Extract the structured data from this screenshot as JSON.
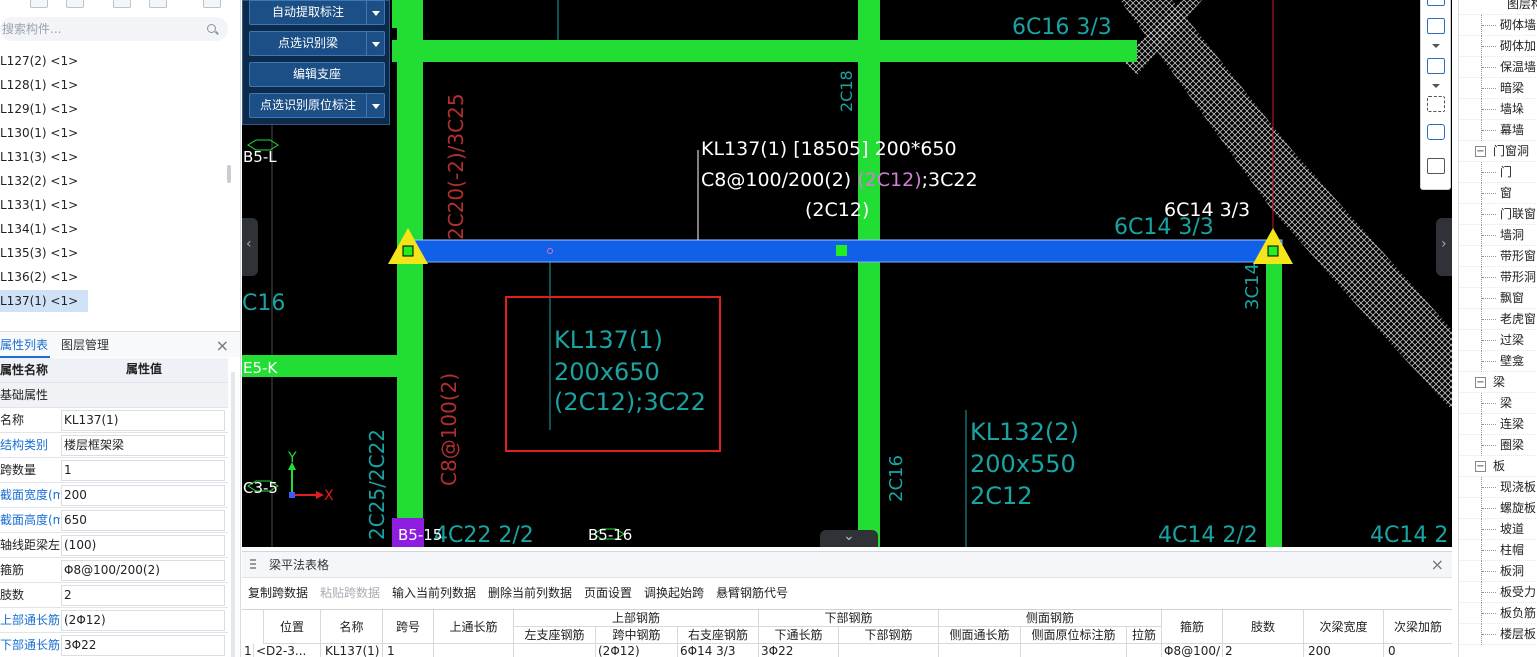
{
  "left_panel": {
    "search_placeholder": "搜索构件...",
    "component_list": [
      "L127(2) <1>",
      "L128(1) <1>",
      "L129(1) <1>",
      "L130(1) <1>",
      "L131(3) <1>",
      "L132(2) <1>",
      "L133(1) <1>",
      "L134(1) <1>",
      "L135(3) <1>",
      "L136(2) <1>",
      "L137(1) <1>"
    ],
    "selected_item": "L137(1) <1>",
    "tabs": [
      "属性列表",
      "图层管理"
    ],
    "prop_header": {
      "name": "属性名称",
      "value": "属性值"
    },
    "prop_group": "基础属性",
    "properties": [
      {
        "name": "名称",
        "value": "KL137(1)",
        "blue": false
      },
      {
        "name": "结构类别",
        "value": "楼层框架梁",
        "blue": true
      },
      {
        "name": "跨数量",
        "value": "1",
        "blue": false
      },
      {
        "name": "截面宽度(mm)",
        "value": "200",
        "blue": true
      },
      {
        "name": "截面高度(mm)",
        "value": "650",
        "blue": true
      },
      {
        "name": "轴线距梁左...",
        "value": "(100)",
        "blue": false
      },
      {
        "name": "箍筋",
        "value": "Φ8@100/200(2)",
        "blue": false
      },
      {
        "name": "肢数",
        "value": "2",
        "blue": false
      },
      {
        "name": "上部通长筋",
        "value": "(2Φ12)",
        "blue": true
      },
      {
        "name": "下部通长筋",
        "value": "3Φ22",
        "blue": true
      }
    ]
  },
  "tool_panel": {
    "buttons": [
      {
        "label": "自动提取标注",
        "has_dropdown": true
      },
      {
        "label": "点选识别梁",
        "has_dropdown": true
      },
      {
        "label": "编辑支座",
        "has_dropdown": false
      },
      {
        "label": "点选识别原位标注",
        "has_dropdown": true
      }
    ]
  },
  "canvas": {
    "beam_label_line1": "KL137(1) [18505] 200*650",
    "beam_label_line2_a": "C8@100/200(2) ",
    "beam_label_line2_b": "(2C12)",
    "beam_label_line2_c": ";3C22",
    "beam_label_line3": "(2C12)",
    "right_support_label": "6C14 3/3",
    "cad_texts": {
      "t_6c16": "6C16 3/3",
      "t_2c18": "2C18",
      "t_2c20": "2C20(-2)/3C25",
      "t_6c14": "6C14 3/3",
      "t_3c14": "3C14",
      "t_c16": "C16",
      "t_kl137_1": "KL137(1)",
      "t_kl137_2": "200x650",
      "t_kl137_3": "(2C12);3C22",
      "t_kl132_1": "KL132(2)",
      "t_kl132_2": "200x550",
      "t_kl132_3": "2C12",
      "t_2c25": "2C25/2C22",
      "t_c8": "C8@100(2)",
      "t_2c16": "2C16",
      "t_4c22": "4C22 2/2",
      "t_4c14a": "4C14 2/2",
      "t_4c14b": "4C14 2",
      "axis_b5l": "B5-L",
      "axis_e5k": "E5-K",
      "axis_c35": "C3-5",
      "axis_b515": "B5-15",
      "axis_b516": "B5-16",
      "ucs_x": "X",
      "ucs_y": "Y"
    },
    "colors": {
      "beam_green": "#22dd33",
      "selected_beam": "#1060e8",
      "rebar_text": "#1aa3a3",
      "red_text": "#b03030",
      "highlight_box": "#e02020",
      "support_marker": "#f4e41a"
    }
  },
  "table_panel": {
    "title": "梁平法表格",
    "toolbar": [
      {
        "label": "复制跨数据",
        "disabled": false
      },
      {
        "label": "粘贴跨数据",
        "disabled": true
      },
      {
        "label": "输入当前列数据",
        "disabled": false
      },
      {
        "label": "删除当前列数据",
        "disabled": false
      },
      {
        "label": "页面设置",
        "disabled": false
      },
      {
        "label": "调换起始跨",
        "disabled": false
      },
      {
        "label": "悬臂钢筋代号",
        "disabled": false
      }
    ],
    "group_headers": {
      "top_rebar": "上部钢筋",
      "bottom_rebar": "下部钢筋",
      "side_rebar": "侧面钢筋"
    },
    "columns": {
      "pos": "位置",
      "name": "名称",
      "span": "跨号",
      "top_cont": "上通长筋",
      "left_support": "左支座钢筋",
      "mid_span": "跨中钢筋",
      "right_support": "右支座钢筋",
      "bottom_cont": "下通长筋",
      "bottom_rebar": "下部钢筋",
      "side_cont": "侧面通长筋",
      "side_orig": "侧面原位标注筋",
      "tie": "拉筋",
      "stirrup": "箍筋",
      "legs": "肢数",
      "sec_width": "次梁宽度",
      "sec_add": "次梁加筋"
    },
    "row": {
      "index": "1",
      "pos": "<D2-3...",
      "name": "KL137(1)",
      "span": "1",
      "top_cont": "",
      "left_support": "",
      "mid_span": "(2Φ12)",
      "right_support": "6Φ14 3/3",
      "bottom_cont": "3Φ22",
      "bottom_rebar": "",
      "side_cont": "",
      "side_orig": "",
      "tie": "",
      "stirrup": "Φ8@100/",
      "legs": "2",
      "sec_width": "200",
      "sec_add": "0"
    }
  },
  "layer_tree": {
    "rows": [
      {
        "label": "图层构",
        "type": "top"
      },
      {
        "label": "砌体墙",
        "type": "leaf"
      },
      {
        "label": "砌体加",
        "type": "leaf"
      },
      {
        "label": "保温墙",
        "type": "leaf"
      },
      {
        "label": "暗梁",
        "type": "leaf"
      },
      {
        "label": "墙垛",
        "type": "leaf"
      },
      {
        "label": "幕墙",
        "type": "leaf"
      },
      {
        "label": "门窗洞",
        "type": "cat"
      },
      {
        "label": "门",
        "type": "leaf"
      },
      {
        "label": "窗",
        "type": "leaf"
      },
      {
        "label": "门联窗",
        "type": "leaf"
      },
      {
        "label": "墙洞",
        "type": "leaf"
      },
      {
        "label": "带形窗",
        "type": "leaf"
      },
      {
        "label": "带形洞",
        "type": "leaf"
      },
      {
        "label": "飘窗",
        "type": "leaf"
      },
      {
        "label": "老虎窗",
        "type": "leaf"
      },
      {
        "label": "过梁",
        "type": "leaf"
      },
      {
        "label": "壁龛",
        "type": "leaf"
      },
      {
        "label": "梁",
        "type": "cat"
      },
      {
        "label": "梁",
        "type": "leaf"
      },
      {
        "label": "连梁",
        "type": "leaf"
      },
      {
        "label": "圈梁",
        "type": "leaf"
      },
      {
        "label": "板",
        "type": "cat"
      },
      {
        "label": "现浇板",
        "type": "leaf"
      },
      {
        "label": "螺旋板",
        "type": "leaf"
      },
      {
        "label": "坡道",
        "type": "leaf"
      },
      {
        "label": "柱帽",
        "type": "leaf"
      },
      {
        "label": "板洞",
        "type": "leaf"
      },
      {
        "label": "板受力",
        "type": "leaf"
      },
      {
        "label": "板负筋",
        "type": "leaf"
      },
      {
        "label": "楼层板",
        "type": "leaf"
      }
    ]
  }
}
